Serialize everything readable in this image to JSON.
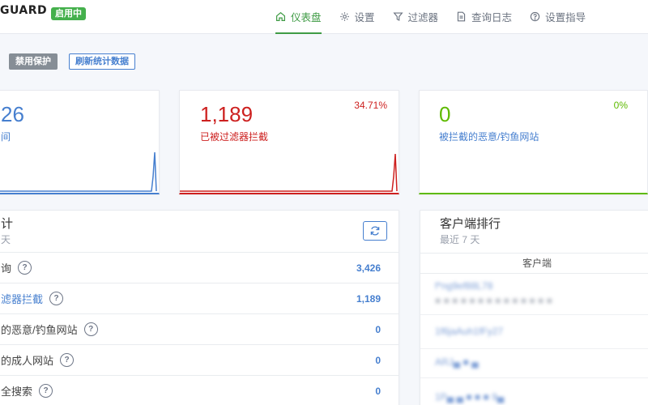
{
  "header": {
    "brand": "GUARD",
    "status_badge": "启用中",
    "nav": [
      {
        "label": "仪表盘",
        "icon": "home-icon",
        "active": true
      },
      {
        "label": "设置",
        "icon": "gear-icon",
        "active": false
      },
      {
        "label": "过滤器",
        "icon": "filter-icon",
        "active": false
      },
      {
        "label": "查询日志",
        "icon": "document-icon",
        "active": false
      },
      {
        "label": "设置指导",
        "icon": "help-circle-icon",
        "active": false
      }
    ]
  },
  "toolbar": {
    "disable_label": "禁用保护",
    "refresh_label": "刷新统计数据"
  },
  "stat_cards": [
    {
      "value": "26",
      "label": "间",
      "percent": "",
      "color": "#467fcf"
    },
    {
      "value": "1,189",
      "label": "已被过滤器拦截",
      "percent": "34.71%",
      "color": "#cd201f"
    },
    {
      "value": "0",
      "label": "被拦截的恶意/钓鱼网站",
      "percent": "0%",
      "color": "#5eba00"
    }
  ],
  "general_stats": {
    "title": "计",
    "subtitle": "天",
    "rows": [
      {
        "label": "询",
        "value": "3,426",
        "link": false
      },
      {
        "label": "滤器拦截",
        "value": "1,189",
        "link": true
      },
      {
        "label": "的恶意/钓鱼网站",
        "value": "0",
        "link": false
      },
      {
        "label": "的成人网站",
        "value": "0",
        "link": false
      },
      {
        "label": "全搜索",
        "value": "0",
        "link": false
      }
    ]
  },
  "top_clients": {
    "title": "客户端排行",
    "subtitle": "最近 7 天",
    "column_header": "客户端",
    "rows": [
      "f*ng9ef88L78",
      "■ ■ ■ ■ ■ ■ ■ ■ ■ ■ ■ ■ ■ ■",
      "1f6jaAuh1fFy27",
      "ARJ▄ ■ ▄",
      "1P▄ ▄ ■ ■ ■ 9▄"
    ]
  },
  "colors": {
    "accent_green": "#3f9b45",
    "blue": "#467fcf",
    "red": "#cd201f",
    "green": "#5eba00"
  }
}
